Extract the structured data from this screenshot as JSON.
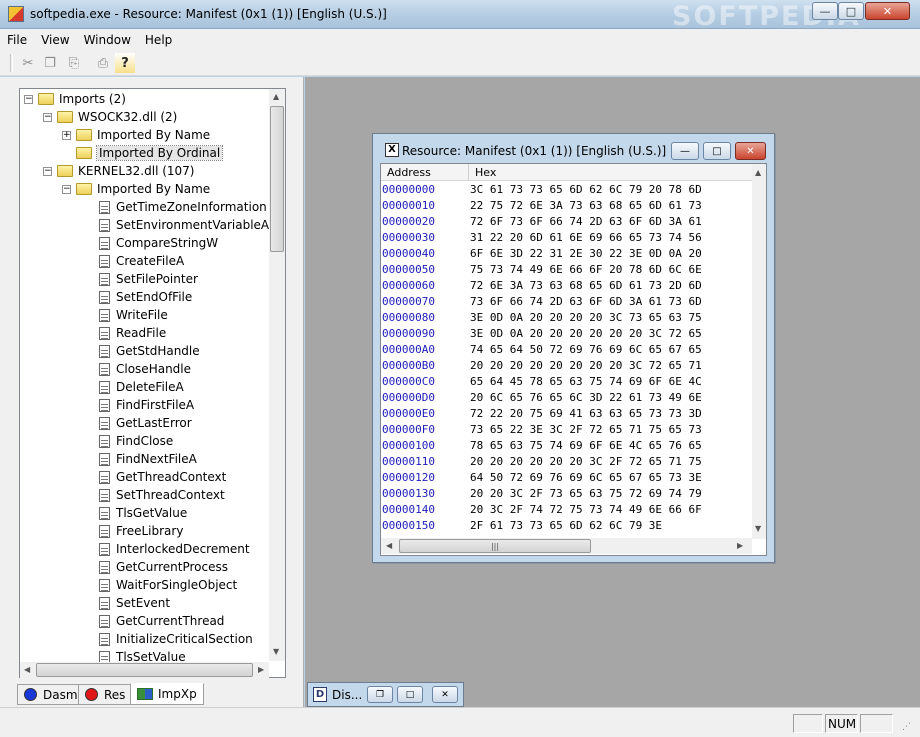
{
  "window": {
    "title": "softpedia.exe - Resource: Manifest (0x1 (1)) [English (U.S.)]",
    "watermark": "SOFTPEDIA",
    "min_label": "—",
    "max_label": "□",
    "close_label": "✕"
  },
  "menu": [
    "File",
    "View",
    "Window",
    "Help"
  ],
  "toolbar": {
    "icons": [
      "cut-icon",
      "copy-icon",
      "paste-icon",
      "print-icon",
      "help-icon"
    ],
    "glyphs": [
      "✂",
      "❐",
      "⎘",
      "⎙",
      "?"
    ]
  },
  "tree": {
    "imports": "Imports (2)",
    "wsock": "WSOCK32.dll (2)",
    "wsock_by_name": "Imported By Name",
    "wsock_by_ordinal": "Imported By Ordinal",
    "kernel": "KERNEL32.dll (107)",
    "kernel_by_name": "Imported By Name",
    "functions": [
      "GetTimeZoneInformation",
      "SetEnvironmentVariableA",
      "CompareStringW",
      "CreateFileA",
      "SetFilePointer",
      "SetEndOfFile",
      "WriteFile",
      "ReadFile",
      "GetStdHandle",
      "CloseHandle",
      "DeleteFileA",
      "FindFirstFileA",
      "GetLastError",
      "FindClose",
      "FindNextFileA",
      "GetThreadContext",
      "SetThreadContext",
      "TlsGetValue",
      "FreeLibrary",
      "InterlockedDecrement",
      "GetCurrentProcess",
      "WaitForSingleObject",
      "SetEvent",
      "GetCurrentThread",
      "InitializeCriticalSection",
      "TlsSetValue"
    ]
  },
  "tabs": [
    "Dasm",
    "Res",
    "ImpXp"
  ],
  "child": {
    "title": "Resource: Manifest (0x1 (1)) [English (U.S.)]",
    "col_address": "Address",
    "col_hex": "Hex",
    "rows": [
      {
        "addr": "00000000",
        "hex": "3C 61 73 73 65 6D 62 6C 79 20 78 6D"
      },
      {
        "addr": "00000010",
        "hex": "22 75 72 6E 3A 73 63 68 65 6D 61 73"
      },
      {
        "addr": "00000020",
        "hex": "72 6F 73 6F 66 74 2D 63 6F 6D 3A 61"
      },
      {
        "addr": "00000030",
        "hex": "31 22 20 6D 61 6E 69 66 65 73 74 56"
      },
      {
        "addr": "00000040",
        "hex": "6F 6E 3D 22 31 2E 30 22 3E 0D 0A 20"
      },
      {
        "addr": "00000050",
        "hex": "75 73 74 49 6E 66 6F 20 78 6D 6C 6E"
      },
      {
        "addr": "00000060",
        "hex": "72 6E 3A 73 63 68 65 6D 61 73 2D 6D"
      },
      {
        "addr": "00000070",
        "hex": "73 6F 66 74 2D 63 6F 6D 3A 61 73 6D"
      },
      {
        "addr": "00000080",
        "hex": "3E 0D 0A 20 20 20 20 3C 73 65 63 75"
      },
      {
        "addr": "00000090",
        "hex": "3E 0D 0A 20 20 20 20 20 20 3C 72 65"
      },
      {
        "addr": "000000A0",
        "hex": "74 65 64 50 72 69 76 69 6C 65 67 65"
      },
      {
        "addr": "000000B0",
        "hex": "20 20 20 20 20 20 20 20 3C 72 65 71"
      },
      {
        "addr": "000000C0",
        "hex": "65 64 45 78 65 63 75 74 69 6F 6E 4C"
      },
      {
        "addr": "000000D0",
        "hex": "20 6C 65 76 65 6C 3D 22 61 73 49 6E"
      },
      {
        "addr": "000000E0",
        "hex": "72 22 20 75 69 41 63 63 65 73 73 3D"
      },
      {
        "addr": "000000F0",
        "hex": "73 65 22 3E 3C 2F 72 65 71 75 65 73"
      },
      {
        "addr": "00000100",
        "hex": "78 65 63 75 74 69 6F 6E 4C 65 76 65"
      },
      {
        "addr": "00000110",
        "hex": "20 20 20 20 20 20 3C 2F 72 65 71 75"
      },
      {
        "addr": "00000120",
        "hex": "64 50 72 69 76 69 6C 65 67 65 73 3E"
      },
      {
        "addr": "00000130",
        "hex": "20 20 3C 2F 73 65 63 75 72 69 74 79"
      },
      {
        "addr": "00000140",
        "hex": "20 3C 2F 74 72 75 73 74 49 6E 66 6F"
      },
      {
        "addr": "00000150",
        "hex": "2F 61 73 73 65 6D 62 6C 79 3E"
      }
    ]
  },
  "minimized": {
    "title": "Dis..."
  },
  "status": {
    "num": "NUM"
  }
}
